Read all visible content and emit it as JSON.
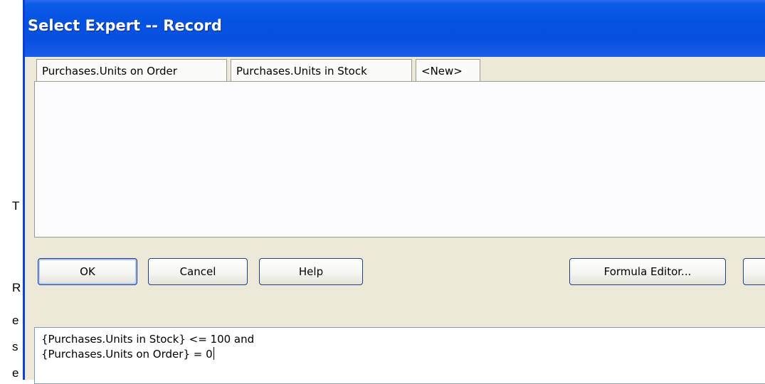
{
  "background": {
    "glyphs": [
      "T",
      "R",
      "e",
      "s",
      "e"
    ]
  },
  "window": {
    "title": "Select Expert -- Record",
    "tabs": [
      {
        "label": "Purchases.Units on Order"
      },
      {
        "label": "Purchases.Units in Stock"
      },
      {
        "label": "<New>"
      }
    ],
    "buttons": {
      "ok": "OK",
      "cancel": "Cancel",
      "help": "Help",
      "formula_editor": "Formula Editor...",
      "partial": ""
    },
    "formula": {
      "line1": "{Purchases.Units in Stock} <= 100 and",
      "line2": "{Purchases.Units on Order} = 0"
    }
  },
  "colors": {
    "titlebar": "#0652e0",
    "dialog_face": "#ece9d8",
    "button_border": "#1f3f87"
  }
}
